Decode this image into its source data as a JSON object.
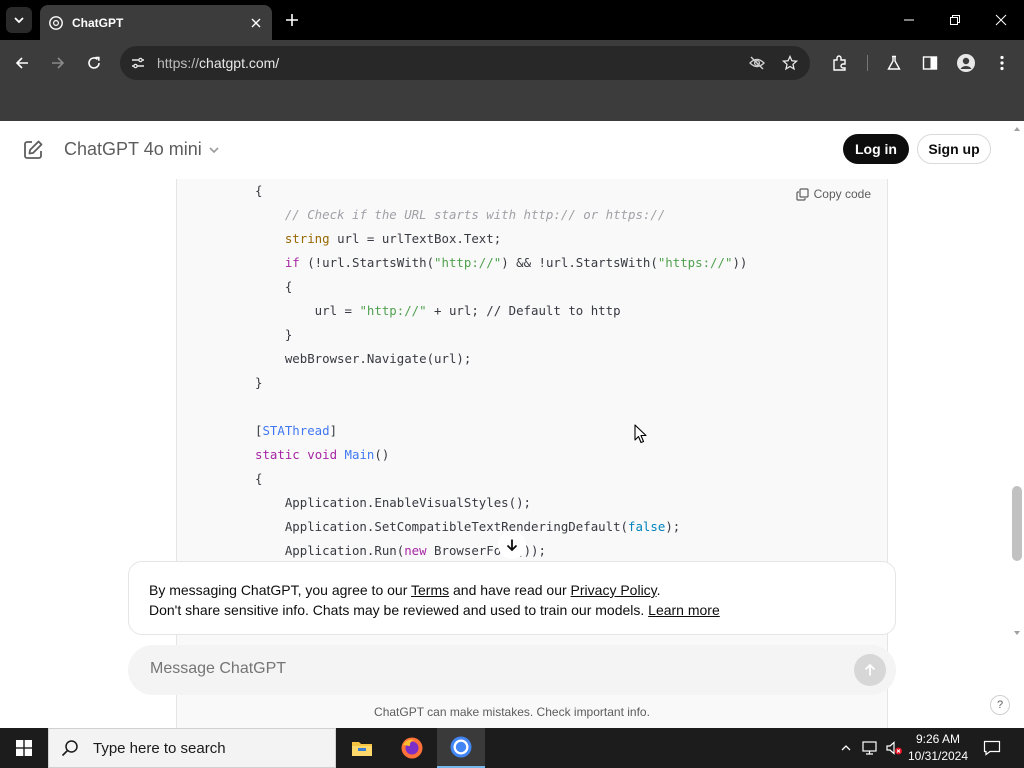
{
  "browser": {
    "tab_title": "ChatGPT",
    "url_scheme": "https://",
    "url_host": "chatgpt.com/",
    "icons": [
      "tab-list-icon",
      "chatgpt-favicon",
      "close-icon",
      "plus-icon",
      "minimize-icon",
      "restore-icon",
      "window-close-icon",
      "back-icon",
      "forward-icon",
      "reload-icon",
      "site-info-icon",
      "eye-off-icon",
      "star-icon",
      "extensions-icon",
      "labs-icon",
      "side-panel-icon",
      "profile-icon",
      "menu-icon"
    ]
  },
  "header": {
    "model_name": "ChatGPT 4o mini",
    "login_label": "Log in",
    "signup_label": "Sign up"
  },
  "code_block": {
    "copy_label": "Copy code",
    "lines": [
      "{",
      "    // Check if the URL starts with http:// or https://",
      "    string url = urlTextBox.Text;",
      "    if (!url.StartsWith(\"http://\") && !url.StartsWith(\"https://\"))",
      "    {",
      "        url = \"http://\" + url; // Default to http",
      "    }",
      "    webBrowser.Navigate(url);",
      "}",
      "",
      "[STAThread]",
      "static void Main()",
      "{",
      "    Application.EnableVisualStyles();",
      "    Application.SetCompatibleTextRenderingDefault(false);",
      "    Application.Run(new BrowserForm());"
    ]
  },
  "consent": {
    "line1_prefix": "By messaging ChatGPT, you agree to our ",
    "terms_link": "Terms",
    "line1_middle": " and have read our ",
    "privacy_link": "Privacy Policy",
    "line1_suffix": ".",
    "line2_prefix": "Don't share sensitive info. Chats may be reviewed and used to train our models. ",
    "learn_more_link": "Learn more"
  },
  "composer": {
    "placeholder": "Message ChatGPT"
  },
  "disclaimer": "ChatGPT can make mistakes. Check important info.",
  "help_label": "?",
  "taskbar": {
    "search_placeholder": "Type here to search",
    "time": "9:26 AM",
    "date": "10/31/2024",
    "apps": [
      "file-explorer-icon",
      "firefox-icon",
      "chrome-icon"
    ]
  }
}
